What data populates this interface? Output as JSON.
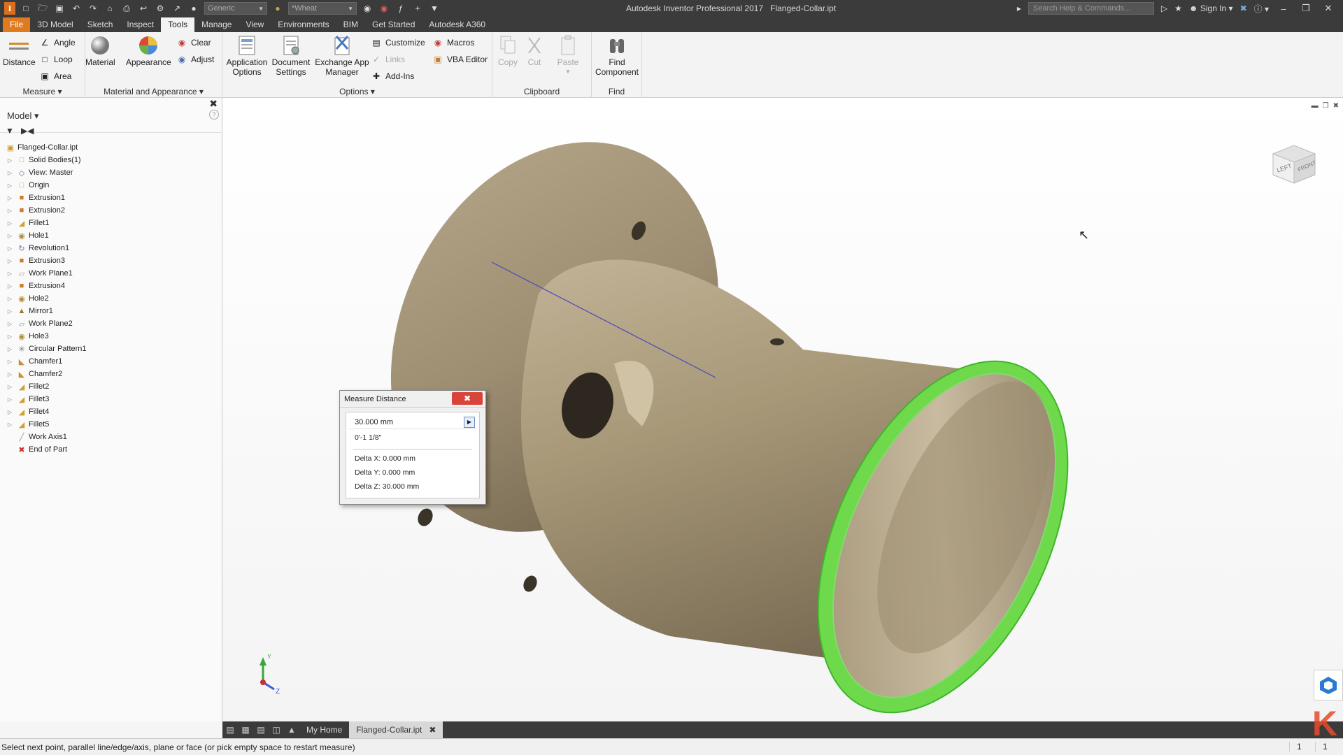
{
  "app": {
    "title": "Autodesk Inventor Professional 2017",
    "document": "Flanged-Collar.ipt"
  },
  "quick_access": {
    "material_combo": "Generic",
    "appearance_combo": "*Wheat",
    "search_placeholder": "Search Help & Commands...",
    "sign_in": "Sign In"
  },
  "ribbon_tabs": [
    {
      "label": "File"
    },
    {
      "label": "3D Model"
    },
    {
      "label": "Sketch"
    },
    {
      "label": "Inspect"
    },
    {
      "label": "Tools",
      "active": true
    },
    {
      "label": "Manage"
    },
    {
      "label": "View"
    },
    {
      "label": "Environments"
    },
    {
      "label": "BIM"
    },
    {
      "label": "Get Started"
    },
    {
      "label": "Autodesk A360"
    }
  ],
  "ribbon": {
    "measure": {
      "title": "Measure",
      "distance": "Distance",
      "angle": "Angle",
      "loop": "Loop",
      "area": "Area"
    },
    "material_appearance": {
      "title": "Material and Appearance",
      "material": "Material",
      "appearance": "Appearance",
      "clear": "Clear",
      "adjust": "Adjust"
    },
    "options": {
      "title": "Options",
      "application_options": "Application Options",
      "document_settings": "Document Settings",
      "exchange_app_manager": "Exchange App Manager",
      "customize": "Customize",
      "links": "Links",
      "add_ins": "Add-Ins",
      "macros": "Macros",
      "vba_editor": "VBA Editor"
    },
    "clipboard": {
      "title": "Clipboard",
      "copy": "Copy",
      "cut": "Cut",
      "paste": "Paste"
    },
    "find": {
      "title": "Find",
      "find_component": "Find Component"
    }
  },
  "browser": {
    "title": "Model",
    "items": [
      {
        "label": "Flanged-Collar.ipt",
        "icon": "part-icon",
        "root": true
      },
      {
        "label": "Solid Bodies(1)",
        "icon": "folder-icon"
      },
      {
        "label": "View: Master",
        "icon": "view-icon"
      },
      {
        "label": "Origin",
        "icon": "folder-icon"
      },
      {
        "label": "Extrusion1",
        "icon": "extrusion-icon"
      },
      {
        "label": "Extrusion2",
        "icon": "extrusion-icon"
      },
      {
        "label": "Fillet1",
        "icon": "fillet-icon"
      },
      {
        "label": "Hole1",
        "icon": "hole-icon"
      },
      {
        "label": "Revolution1",
        "icon": "revolution-icon"
      },
      {
        "label": "Extrusion3",
        "icon": "extrusion-icon"
      },
      {
        "label": "Work Plane1",
        "icon": "workplane-icon"
      },
      {
        "label": "Extrusion4",
        "icon": "extrusion-icon"
      },
      {
        "label": "Hole2",
        "icon": "hole-icon"
      },
      {
        "label": "Mirror1",
        "icon": "mirror-icon"
      },
      {
        "label": "Work Plane2",
        "icon": "workplane-icon"
      },
      {
        "label": "Hole3",
        "icon": "hole-icon"
      },
      {
        "label": "Circular Pattern1",
        "icon": "pattern-icon"
      },
      {
        "label": "Chamfer1",
        "icon": "chamfer-icon"
      },
      {
        "label": "Chamfer2",
        "icon": "chamfer-icon"
      },
      {
        "label": "Fillet2",
        "icon": "fillet-icon"
      },
      {
        "label": "Fillet3",
        "icon": "fillet-icon"
      },
      {
        "label": "Fillet4",
        "icon": "fillet-icon"
      },
      {
        "label": "Fillet5",
        "icon": "fillet-icon"
      },
      {
        "label": "Work Axis1",
        "icon": "workaxis-icon"
      },
      {
        "label": "End of Part",
        "icon": "end-of-part-icon"
      }
    ]
  },
  "measure_dialog": {
    "title": "Measure Distance",
    "value": "30.000 mm",
    "imperial": "0'-1 1/8\"",
    "delta_x": "Delta X: 0.000 mm",
    "delta_y": "Delta Y: 0.000 mm",
    "delta_z": "Delta Z: 30.000 mm"
  },
  "viewcube": {
    "left": "LEFT",
    "front": "FRONT"
  },
  "triad": {
    "y": "Y",
    "z": "Z"
  },
  "doc_tabs": {
    "home": "My Home",
    "active": "Flanged-Collar.ipt"
  },
  "status": {
    "message": "Select next point, parallel line/edge/axis, plane or face (or pick empty space to restart measure)",
    "count1": "1",
    "count2": "1"
  },
  "colors": {
    "accent": "#e07a1f",
    "highlight": "#5ad43a",
    "part": "#b7a98e"
  }
}
